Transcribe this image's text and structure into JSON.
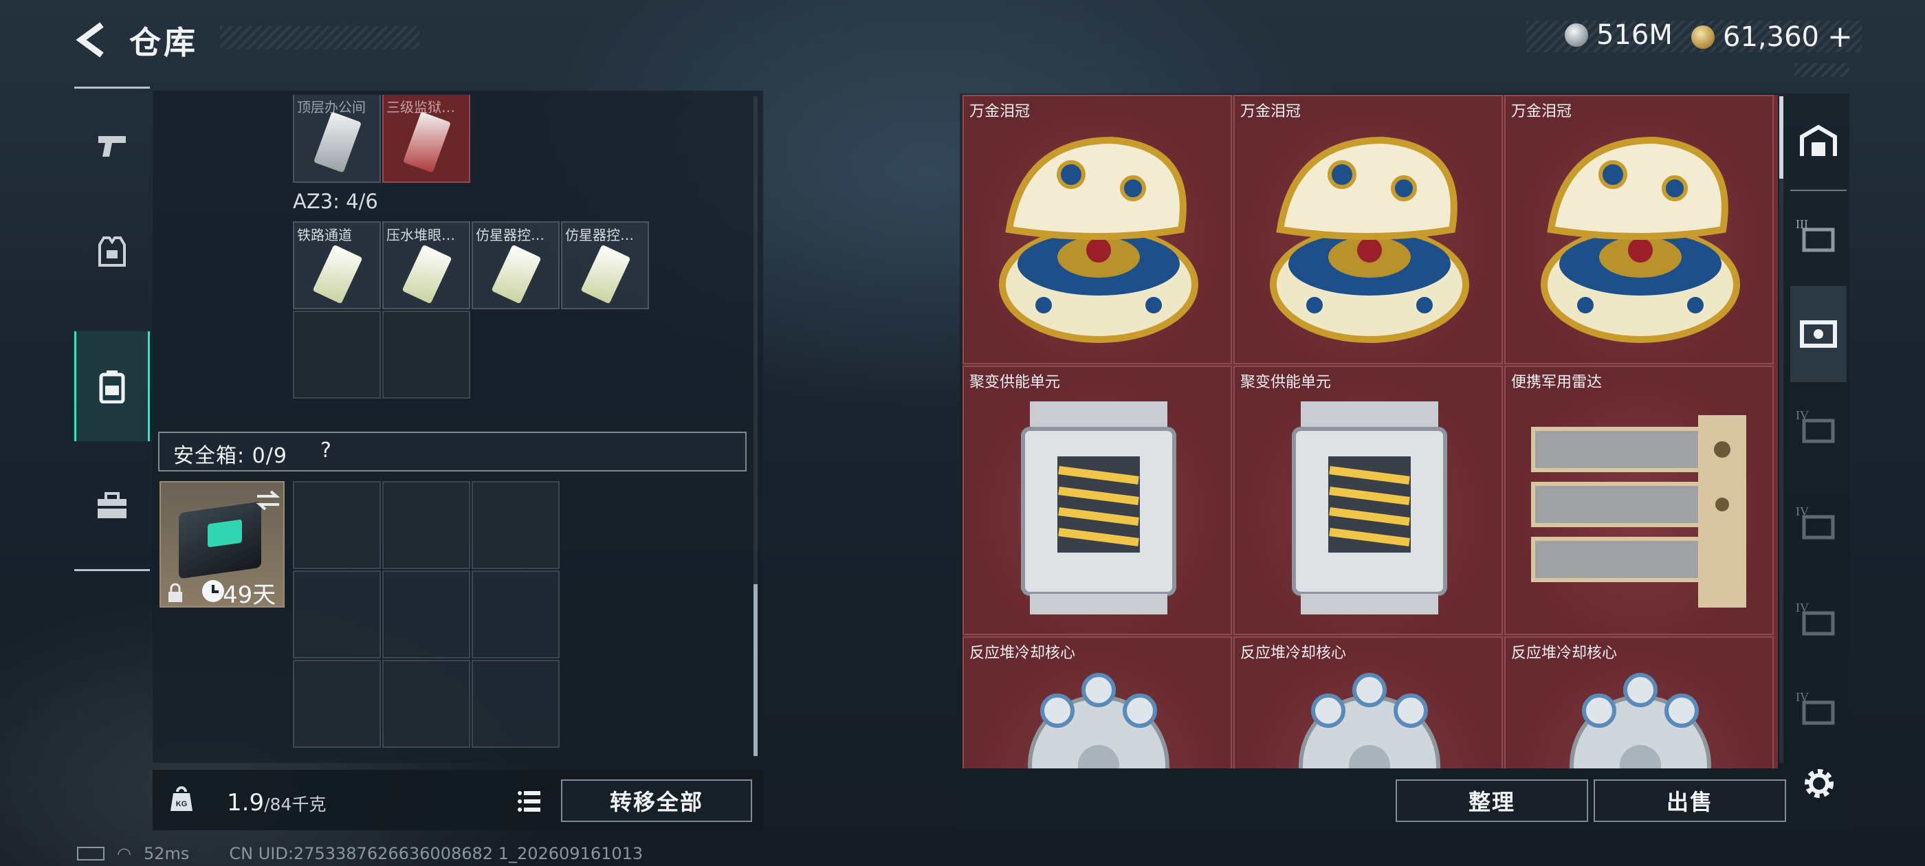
{
  "header": {
    "title": "仓库",
    "currency_1": "516M",
    "currency_2": "61,360",
    "currency_2_add": "+"
  },
  "left_nav": {
    "items": [
      {
        "name": "weapons-icon"
      },
      {
        "name": "armor-icon"
      },
      {
        "name": "backpack-icon"
      },
      {
        "name": "toolbox-icon"
      }
    ],
    "active_index": 2
  },
  "keys": {
    "row1": [
      "顶层办公间",
      "三级监狱…"
    ],
    "az3_label": "AZ3: 4/6",
    "row2": [
      "铁路通道",
      "压水堆眼…",
      "仿星器控…",
      "仿星器控…"
    ]
  },
  "safe_box": {
    "label": "安全箱: 0/9",
    "help": "?",
    "days": "49天"
  },
  "weight": {
    "current": "1.9",
    "max": "/84千克",
    "transfer_all": "转移全部"
  },
  "status_bar": {
    "ping": "52ms",
    "uid": "CN UID:2753387626636008682 1_202609161013"
  },
  "stash": {
    "items": [
      {
        "label": "万金泪冠",
        "kind": "egg"
      },
      {
        "label": "万金泪冠",
        "kind": "egg"
      },
      {
        "label": "万金泪冠",
        "kind": "egg"
      },
      {
        "label": "聚变供能单元",
        "kind": "fusion"
      },
      {
        "label": "聚变供能单元",
        "kind": "fusion"
      },
      {
        "label": "便携军用雷达",
        "kind": "radar"
      },
      {
        "label": "反应堆冷却核心",
        "kind": "core"
      },
      {
        "label": "反应堆冷却核心",
        "kind": "core"
      },
      {
        "label": "反应堆冷却核心",
        "kind": "core"
      }
    ],
    "sort": "整理",
    "sell": "出售"
  },
  "right_nav": {
    "tiers": [
      "",
      "III",
      "",
      "IV",
      "IV",
      "IV",
      "IV"
    ]
  },
  "colors": {
    "stash_cell": "#6d2e35",
    "accent": "#3ee0c4"
  }
}
